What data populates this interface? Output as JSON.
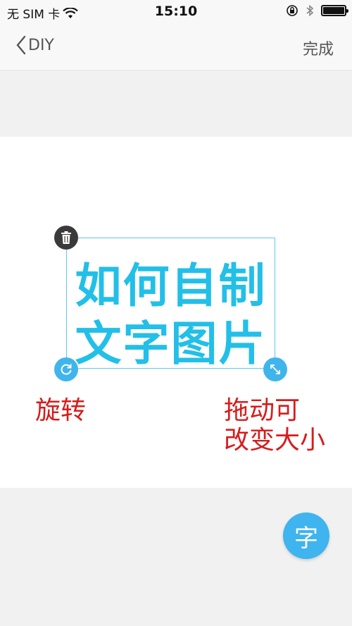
{
  "status_bar": {
    "carrier": "无 SIM 卡",
    "time": "15:10"
  },
  "nav": {
    "back_label": "DIY",
    "done_label": "完成"
  },
  "sticker": {
    "line1": "如何自制",
    "line2": "文字图片",
    "color": "#22bfe8"
  },
  "annotations": {
    "rotate": "旋转",
    "resize_line1": "拖动可",
    "resize_line2": "改变大小",
    "color": "#d61c1c"
  },
  "fab": {
    "label": "字",
    "color": "#3fb4ef"
  },
  "icons": {
    "delete": "trash-icon",
    "rotate": "rotate-icon",
    "resize": "resize-arrows-icon"
  }
}
